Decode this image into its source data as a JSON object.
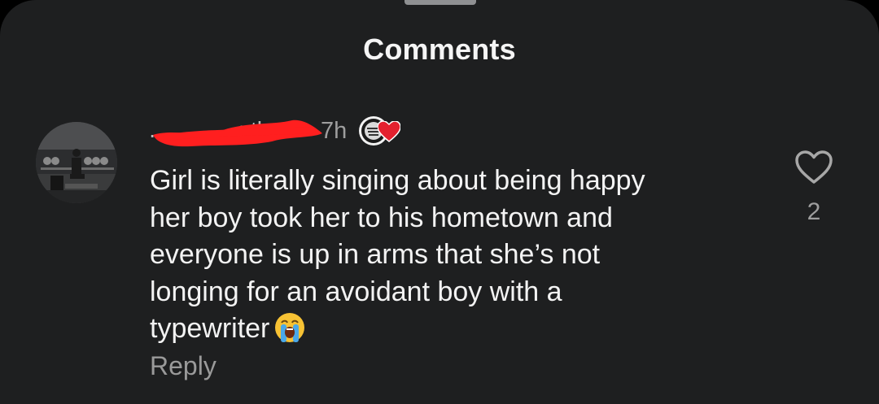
{
  "sheet": {
    "title": "Comments"
  },
  "comment": {
    "username": "…………zth",
    "time_ago": "7h",
    "text_lines": [
      "Girl is literally singing about being happy",
      "her boy took her to his hometown and",
      "everyone is up in arms that she’s not",
      "longing for an avoidant boy with a",
      "typewriter"
    ],
    "emoji": "loudly-crying-face",
    "reply_label": "Reply",
    "like_count": "2",
    "liked_by_creator": true
  },
  "colors": {
    "sheet_bg": "#1e1f20",
    "text_primary": "#f3f3f3",
    "text_secondary": "#9e9e9e",
    "heart_red": "#e3202e",
    "redaction_red": "#ff1f1f"
  },
  "icons": {
    "avatar": "avatar-photo",
    "badge": "profile-badge",
    "creator_heart": "heart-filled-icon",
    "like": "heart-outline-icon"
  }
}
